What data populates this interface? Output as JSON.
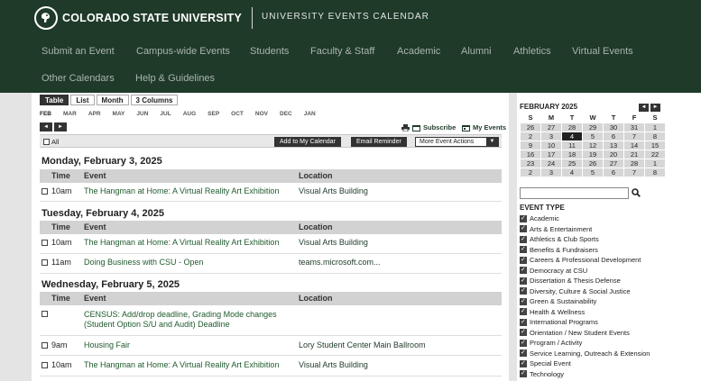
{
  "header": {
    "university": "COLORADO STATE UNIVERSITY",
    "site_name": "UNIVERSITY EVENTS CALENDAR",
    "nav": [
      "Submit an Event",
      "Campus-wide Events",
      "Students",
      "Faculty & Staff",
      "Academic",
      "Alumni",
      "Athletics",
      "Virtual Events",
      "Other Calendars",
      "Help & Guidelines"
    ]
  },
  "views": [
    "Table",
    "List",
    "Month",
    "3 Columns"
  ],
  "months": [
    "FEB",
    "MAR",
    "APR",
    "MAY",
    "JUN",
    "JUL",
    "AUG",
    "SEP",
    "OCT",
    "NOV",
    "DEC",
    "JAN"
  ],
  "pager": {
    "prev": "◄",
    "next": "►"
  },
  "tools": {
    "subscribe": "Subscribe",
    "my_events": "My Events"
  },
  "actions": {
    "all": "All",
    "add": "Add to My Calendar",
    "reminder": "Email Reminder",
    "more": "More Event Actions",
    "more_arrow": "▼"
  },
  "columns": {
    "time": "Time",
    "event": "Event",
    "location": "Location"
  },
  "days": [
    {
      "heading": "Monday, February 3, 2025",
      "events": [
        {
          "time": "10am",
          "title": "The Hangman at Home: A Virtual Reality Art Exhibition",
          "location": "Visual Arts Building"
        }
      ]
    },
    {
      "heading": "Tuesday, February 4, 2025",
      "events": [
        {
          "time": "10am",
          "title": "The Hangman at Home: A Virtual Reality Art Exhibition",
          "location": "Visual Arts Building"
        },
        {
          "time": "11am",
          "title": "Doing Business with CSU - Open",
          "location": "teams.microsoft.com..."
        }
      ]
    },
    {
      "heading": "Wednesday, February 5, 2025",
      "events": [
        {
          "time": "",
          "title": "CENSUS: Add/drop deadline, Grading Mode changes (Student Option S/U and Audit) Deadline",
          "location": ""
        },
        {
          "time": "9am",
          "title": "Housing Fair",
          "location": "Lory Student Center Main Ballroom"
        },
        {
          "time": "10am",
          "title": "The Hangman at Home: A Virtual Reality Art Exhibition",
          "location": "Visual Arts Building"
        }
      ]
    }
  ],
  "mini_calendar": {
    "title": "FEBRUARY 2025",
    "prev": "◄",
    "next": "►",
    "weekdays": [
      "S",
      "M",
      "T",
      "W",
      "T",
      "F",
      "S"
    ],
    "weeks": [
      [
        "26",
        "27",
        "28",
        "29",
        "30",
        "31",
        "1"
      ],
      [
        "2",
        "3",
        "4",
        "5",
        "6",
        "7",
        "8"
      ],
      [
        "9",
        "10",
        "11",
        "12",
        "13",
        "14",
        "15"
      ],
      [
        "16",
        "17",
        "18",
        "19",
        "20",
        "21",
        "22"
      ],
      [
        "23",
        "24",
        "25",
        "26",
        "27",
        "28",
        "1"
      ],
      [
        "2",
        "3",
        "4",
        "5",
        "6",
        "7",
        "8"
      ]
    ],
    "today": "3"
  },
  "search": {
    "placeholder": ""
  },
  "event_type": {
    "heading": "EVENT TYPE",
    "items": [
      "Academic",
      "Arts & Entertainment",
      "Athletics & Club Sports",
      "Benefits & Fundraisers",
      "Careers & Professional Development",
      "Democracy at CSU",
      "Dissertation & Thesis Defense",
      "Diversity, Culture & Social Justice",
      "Green & Sustainability",
      "Health & Wellness",
      "International Programs",
      "Orientation / New Student Events",
      "Program / Activity",
      "Service Learning, Outreach & Extension",
      "Special Event",
      "Technology"
    ]
  },
  "colors": {
    "header_bg": "#1f3a29",
    "accent": "#1f5a2d"
  }
}
